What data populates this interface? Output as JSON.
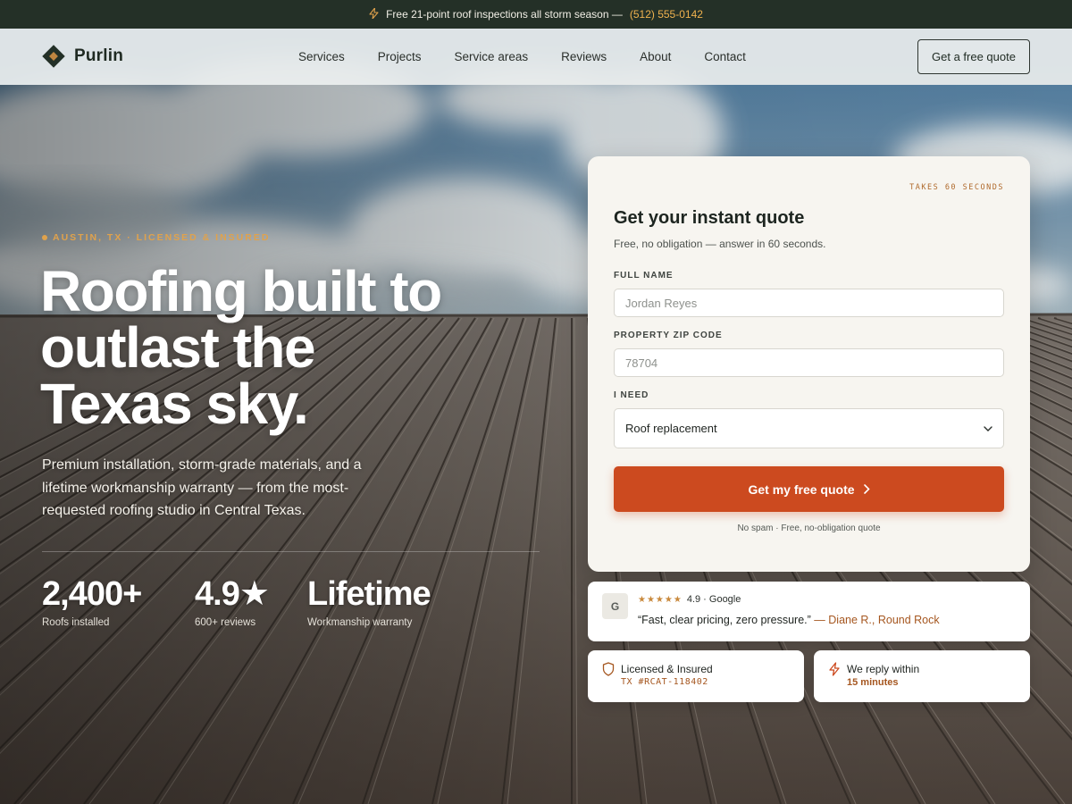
{
  "topbar": {
    "icon": "lightning-icon",
    "message": "Free 21-point roof inspections all storm season —",
    "phone": "(512) 555-0142"
  },
  "nav": {
    "brand": "Purlin",
    "links": [
      "Services",
      "Projects",
      "Service areas",
      "Reviews",
      "About",
      "Contact"
    ],
    "cta": "Get a free quote"
  },
  "hero": {
    "eyebrow": "AUSTIN, TX · LICENSED & INSURED",
    "headline_line1": "Roofing built to",
    "headline_line2": "outlast the",
    "headline_line3": "Texas sky.",
    "subcopy": "Premium installation, storm-grade materials, and a lifetime workmanship warranty — from the most-requested roofing studio in Central Texas.",
    "stats": [
      {
        "value": "2,400+",
        "label": "Roofs installed"
      },
      {
        "value": "4.9★",
        "label": "600+ reviews"
      },
      {
        "value": "Lifetime",
        "label": "Workmanship warranty"
      }
    ]
  },
  "quote_form": {
    "tag": "TAKES 60 SECONDS",
    "title": "Get your instant quote",
    "subtitle": "Free, no obligation — answer in 60 seconds.",
    "name_label": "FULL NAME",
    "name_placeholder": "Jordan Reyes",
    "zip_label": "PROPERTY ZIP CODE",
    "zip_placeholder": "78704",
    "need_label": "I NEED",
    "need_selected": "Roof replacement",
    "submit": "Get my free quote",
    "fineprint": "No spam · Free, no-obligation quote"
  },
  "review": {
    "avatar_letter": "G",
    "stars": "★★★★★",
    "rating_text": "4.9 · Google",
    "quote": "“Fast, clear pricing, zero pressure.”",
    "author": "— Diane R., Round Rock"
  },
  "badges": {
    "licensed_icon": "shield-icon",
    "licensed_title": "Licensed & Insured",
    "licensed_number": "TX #RCAT-118402",
    "reply_icon": "lightning-icon",
    "reply_title": "We reply within",
    "reply_time": "15 minutes"
  },
  "colors": {
    "accent": "#cc4a1f",
    "gold": "#e0a24c",
    "dark": "#243027",
    "author": "#a5561f"
  }
}
